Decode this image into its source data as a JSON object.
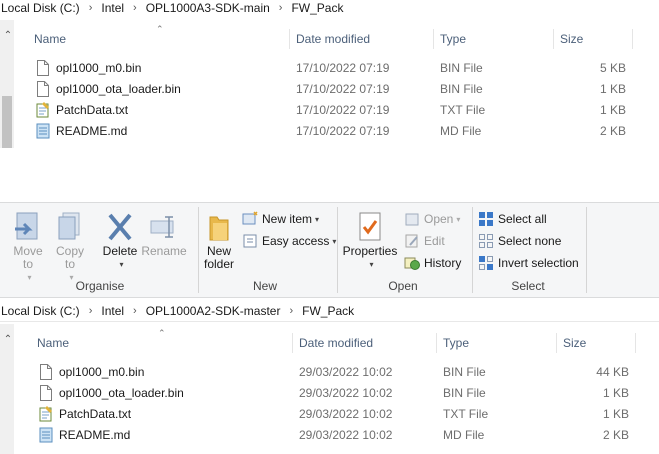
{
  "top": {
    "breadcrumb": [
      "Local Disk (C:)",
      "Intel",
      "OPL1000A3-SDK-main",
      "FW_Pack"
    ],
    "columns": {
      "name": "Name",
      "date": "Date modified",
      "type": "Type",
      "size": "Size"
    },
    "files": [
      {
        "name": "opl1000_m0.bin",
        "date": "17/10/2022 07:19",
        "type": "BIN File",
        "size": "5 KB",
        "icon": "file-icon"
      },
      {
        "name": "opl1000_ota_loader.bin",
        "date": "17/10/2022 07:19",
        "type": "BIN File",
        "size": "1 KB",
        "icon": "file-icon"
      },
      {
        "name": "PatchData.txt",
        "date": "17/10/2022 07:19",
        "type": "TXT File",
        "size": "1 KB",
        "icon": "notepad-icon"
      },
      {
        "name": "README.md",
        "date": "17/10/2022 07:19",
        "type": "MD File",
        "size": "2 KB",
        "icon": "md-file-icon"
      }
    ]
  },
  "ribbon": {
    "organise": {
      "label": "Organise",
      "move_to": "Move to",
      "copy_to": "Copy to",
      "delete": "Delete",
      "rename": "Rename"
    },
    "new": {
      "label": "New",
      "new_folder_1": "New",
      "new_folder_2": "folder",
      "new_item": "New item",
      "easy_access": "Easy access"
    },
    "open": {
      "label": "Open",
      "properties": "Properties",
      "open": "Open",
      "edit": "Edit",
      "history": "History"
    },
    "select": {
      "label": "Select",
      "select_all": "Select all",
      "select_none": "Select none",
      "invert_selection": "Invert selection"
    }
  },
  "bottom": {
    "breadcrumb": [
      "Local Disk (C:)",
      "Intel",
      "OPL1000A2-SDK-master",
      "FW_Pack"
    ],
    "columns": {
      "name": "Name",
      "date": "Date modified",
      "type": "Type",
      "size": "Size"
    },
    "files": [
      {
        "name": "opl1000_m0.bin",
        "date": "29/03/2022 10:02",
        "type": "BIN File",
        "size": "44 KB",
        "icon": "file-icon"
      },
      {
        "name": "opl1000_ota_loader.bin",
        "date": "29/03/2022 10:02",
        "type": "BIN File",
        "size": "1 KB",
        "icon": "file-icon"
      },
      {
        "name": "PatchData.txt",
        "date": "29/03/2022 10:02",
        "type": "TXT File",
        "size": "1 KB",
        "icon": "notepad-icon"
      },
      {
        "name": "README.md",
        "date": "29/03/2022 10:02",
        "type": "MD File",
        "size": "2 KB",
        "icon": "md-file-icon"
      }
    ]
  }
}
